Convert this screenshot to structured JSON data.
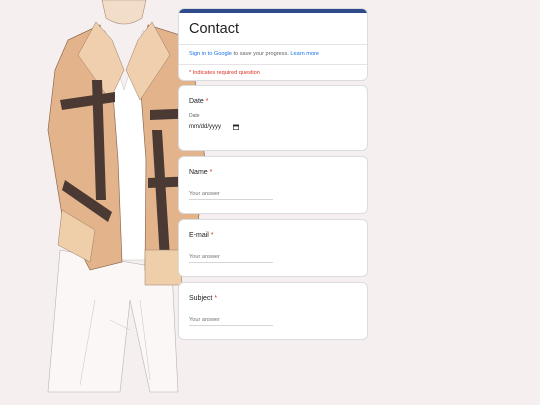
{
  "form": {
    "title": "Contact",
    "signin": {
      "link_text": "Sign in to Google",
      "middle_text": " to save your progress. ",
      "learn_more": "Learn more"
    },
    "required_note": "* Indicates required question"
  },
  "questions": [
    {
      "label": "Date",
      "required_mark": "*",
      "sublabel": "Date",
      "value": "mm/dd/yyyy"
    },
    {
      "label": "Name",
      "required_mark": "*",
      "placeholder": "Your answer"
    },
    {
      "label": "E-mail",
      "required_mark": "*",
      "placeholder": "Your answer"
    },
    {
      "label": "Subject",
      "required_mark": "*",
      "placeholder": "Your answer"
    }
  ],
  "colors": {
    "accent_bar": "#2e4a8a",
    "required": "#d93025",
    "link": "#1a73e8",
    "background": "#f6eff0"
  },
  "icons": [
    "calendar-icon"
  ]
}
